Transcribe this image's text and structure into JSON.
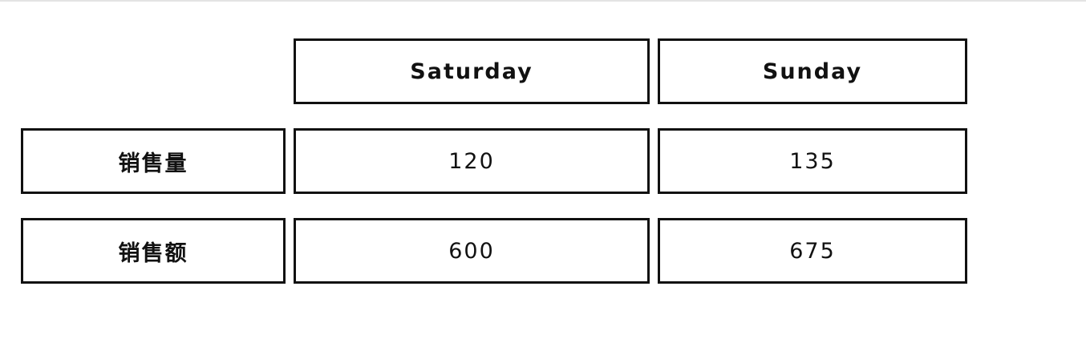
{
  "table": {
    "columns": [
      "Saturday",
      "Sunday"
    ],
    "rows": [
      {
        "label": "销售量",
        "values": [
          "120",
          "135"
        ]
      },
      {
        "label": "销售额",
        "values": [
          "600",
          "675"
        ]
      }
    ]
  },
  "colors": {
    "border": "#111111",
    "text": "#111111",
    "background": "#ffffff",
    "top_rule": "#e3e3e3"
  }
}
